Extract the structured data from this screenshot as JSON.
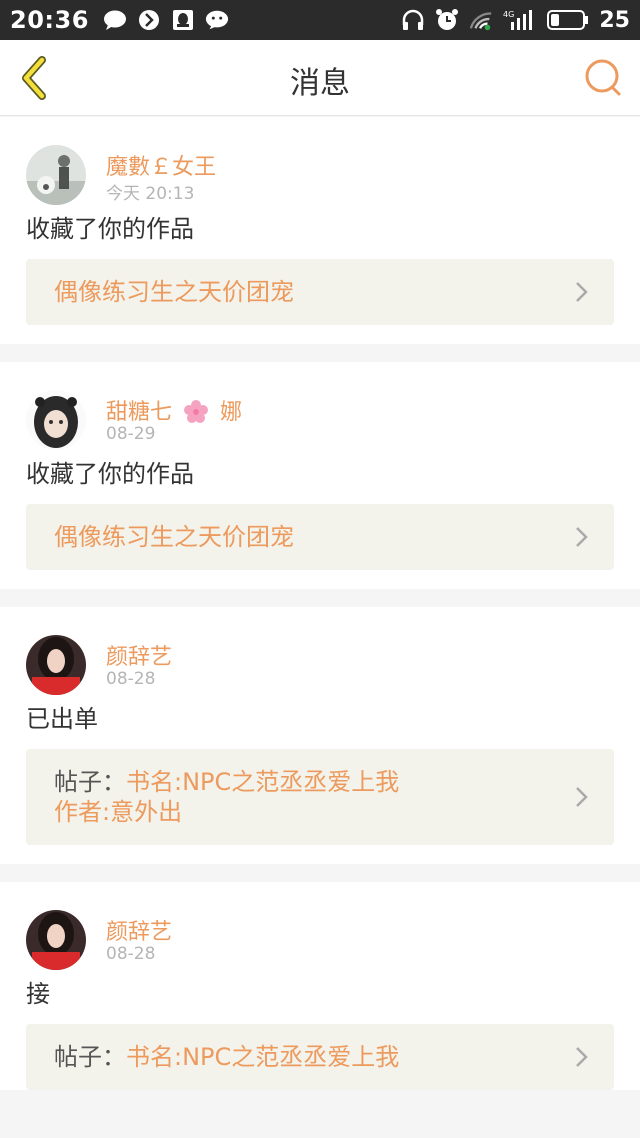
{
  "status_bar": {
    "time": "20:36",
    "battery": "25",
    "network": "4G",
    "left_icons": [
      "chat-bubble-icon",
      "app-icon",
      "qq-icon",
      "wechat-icon"
    ],
    "right_icons": [
      "headphones-icon",
      "alarm-icon",
      "wifi-icon",
      "signal-icon",
      "battery-icon"
    ]
  },
  "nav": {
    "title": "消息",
    "accent": "#ec9a5d"
  },
  "messages": [
    {
      "user": "魔數￡女王",
      "time": "今天 20:13",
      "action": "收藏了你的作品",
      "link_prefix": "",
      "link_text": "偶像练习生之天价团宠",
      "link_text2": ""
    },
    {
      "user": "甜糖七",
      "user_suffix": "娜",
      "time": "08-29",
      "action": "收藏了你的作品",
      "link_prefix": "",
      "link_text": "偶像练习生之天价团宠",
      "link_text2": ""
    },
    {
      "user": "颜辞艺",
      "time": "08-28",
      "action": "已出单",
      "link_prefix": "帖子：",
      "link_text": "书名:NPC之范丞丞爱上我",
      "link_text2": "作者:意外出"
    },
    {
      "user": "颜辞艺",
      "time": "08-28",
      "action": "接",
      "link_prefix": "帖子：",
      "link_text": "书名:NPC之范丞丞爱上我",
      "link_text2": ""
    }
  ]
}
